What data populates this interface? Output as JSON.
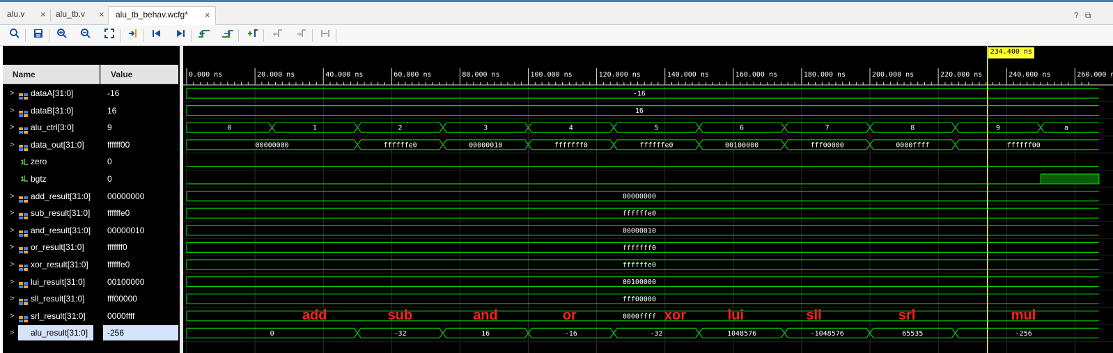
{
  "tabs": [
    {
      "label": "alu.v",
      "close": "×"
    },
    {
      "label": "alu_tb.v",
      "close": "×"
    },
    {
      "label": "alu_tb_behav.wcfg*",
      "close": "×"
    }
  ],
  "window_controls": {
    "help": "?",
    "restore": "⧉"
  },
  "toolbar": {
    "icons": [
      "search-icon",
      "save-icon",
      "zoom-in-icon",
      "zoom-out-icon",
      "zoom-fit-icon",
      "go-to-cursor-icon",
      "go-to-time-zero-icon",
      "go-to-last-time-icon",
      "previous-transition-icon",
      "next-transition-icon",
      "add-marker-icon",
      "previous-marker-icon",
      "next-marker-icon",
      "swap-cursors-icon"
    ]
  },
  "columns": {
    "name": "Name",
    "value": "Value"
  },
  "signals": [
    {
      "name": "dataA[31:0]",
      "value": "-16",
      "type": "bus"
    },
    {
      "name": "dataB[31:0]",
      "value": "16",
      "type": "bus"
    },
    {
      "name": "alu_ctrl[3:0]",
      "value": "9",
      "type": "bus"
    },
    {
      "name": "data_out[31:0]",
      "value": "ffffff00",
      "type": "bus"
    },
    {
      "name": "zero",
      "value": "0",
      "type": "bit"
    },
    {
      "name": "bgtz",
      "value": "0",
      "type": "bit"
    },
    {
      "name": "add_result[31:0]",
      "value": "00000000",
      "type": "bus"
    },
    {
      "name": "sub_result[31:0]",
      "value": "ffffffe0",
      "type": "bus"
    },
    {
      "name": "and_result[31:0]",
      "value": "00000010",
      "type": "bus"
    },
    {
      "name": "or_result[31:0]",
      "value": "fffffff0",
      "type": "bus"
    },
    {
      "name": "xor_result[31:0]",
      "value": "ffffffe0",
      "type": "bus"
    },
    {
      "name": "lui_result[31:0]",
      "value": "00100000",
      "type": "bus"
    },
    {
      "name": "sll_result[31:0]",
      "value": "fff00000",
      "type": "bus"
    },
    {
      "name": "srl_result[31:0]",
      "value": "0000ffff",
      "type": "bus"
    },
    {
      "name": "alu_result[31:0]",
      "value": "-256",
      "type": "bus",
      "selected": true
    }
  ],
  "timeline": {
    "ticks": [
      "0.000 ns",
      "20.000 ns",
      "40.000 ns",
      "60.000 ns",
      "80.000 ns",
      "100.000 ns",
      "120.000 ns",
      "140.000 ns",
      "160.000 ns",
      "180.000 ns",
      "200.000 ns",
      "220.000 ns",
      "240.000 ns",
      "260.000 ns"
    ],
    "cursor_label": "234.400 ns",
    "cursor_time_ns": 234.4,
    "visible_range_ns": [
      0,
      265
    ]
  },
  "waves": [
    {
      "segments": [
        {
          "t0": 0,
          "t1": 265,
          "label": "-16"
        }
      ]
    },
    {
      "segments": [
        {
          "t0": 0,
          "t1": 265,
          "label": "16"
        }
      ]
    },
    {
      "segments": [
        {
          "t0": 0,
          "t1": 25,
          "label": "0"
        },
        {
          "t0": 25,
          "t1": 50,
          "label": "1"
        },
        {
          "t0": 50,
          "t1": 75,
          "label": "2"
        },
        {
          "t0": 75,
          "t1": 100,
          "label": "3"
        },
        {
          "t0": 100,
          "t1": 125,
          "label": "4"
        },
        {
          "t0": 125,
          "t1": 150,
          "label": "5"
        },
        {
          "t0": 150,
          "t1": 175,
          "label": "6"
        },
        {
          "t0": 175,
          "t1": 200,
          "label": "7"
        },
        {
          "t0": 200,
          "t1": 225,
          "label": "8"
        },
        {
          "t0": 225,
          "t1": 250,
          "label": "9"
        },
        {
          "t0": 250,
          "t1": 265,
          "label": "a"
        }
      ]
    },
    {
      "segments": [
        {
          "t0": 0,
          "t1": 50,
          "label": "00000000"
        },
        {
          "t0": 50,
          "t1": 75,
          "label": "ffffffe0"
        },
        {
          "t0": 75,
          "t1": 100,
          "label": "00000010"
        },
        {
          "t0": 100,
          "t1": 125,
          "label": "fffffff0"
        },
        {
          "t0": 125,
          "t1": 150,
          "label": "ffffffe0"
        },
        {
          "t0": 150,
          "t1": 175,
          "label": "00100000"
        },
        {
          "t0": 175,
          "t1": 200,
          "label": "fff00000"
        },
        {
          "t0": 200,
          "t1": 225,
          "label": "0000ffff"
        },
        {
          "t0": 225,
          "t1": 265,
          "label": "ffffff00"
        }
      ]
    },
    {
      "bit": [
        {
          "t0": 0,
          "t1": 265,
          "v": 0
        }
      ]
    },
    {
      "bit": [
        {
          "t0": 0,
          "t1": 250,
          "v": 0
        },
        {
          "t0": 250,
          "t1": 265,
          "v": 1
        }
      ]
    },
    {
      "segments": [
        {
          "t0": 0,
          "t1": 265,
          "label": "00000000"
        }
      ]
    },
    {
      "segments": [
        {
          "t0": 0,
          "t1": 265,
          "label": "ffffffe0"
        }
      ]
    },
    {
      "segments": [
        {
          "t0": 0,
          "t1": 265,
          "label": "00000010"
        }
      ]
    },
    {
      "segments": [
        {
          "t0": 0,
          "t1": 265,
          "label": "fffffff0"
        }
      ]
    },
    {
      "segments": [
        {
          "t0": 0,
          "t1": 265,
          "label": "ffffffe0"
        }
      ]
    },
    {
      "segments": [
        {
          "t0": 0,
          "t1": 265,
          "label": "00100000"
        }
      ]
    },
    {
      "segments": [
        {
          "t0": 0,
          "t1": 265,
          "label": "fff00000"
        }
      ]
    },
    {
      "segments": [
        {
          "t0": 0,
          "t1": 265,
          "label": "0000ffff"
        }
      ]
    },
    {
      "segments": [
        {
          "t0": 0,
          "t1": 50,
          "label": "0"
        },
        {
          "t0": 50,
          "t1": 75,
          "label": "-32"
        },
        {
          "t0": 75,
          "t1": 100,
          "label": "16"
        },
        {
          "t0": 100,
          "t1": 125,
          "label": "-16"
        },
        {
          "t0": 125,
          "t1": 150,
          "label": "-32"
        },
        {
          "t0": 150,
          "t1": 175,
          "label": "1048576"
        },
        {
          "t0": 175,
          "t1": 200,
          "label": "-1048576"
        },
        {
          "t0": 200,
          "t1": 225,
          "label": "65535"
        },
        {
          "t0": 225,
          "t1": 265,
          "label": "-256"
        }
      ]
    }
  ],
  "annotations": [
    {
      "text": "add",
      "t": 37.5
    },
    {
      "text": "sub",
      "t": 62.5
    },
    {
      "text": "and",
      "t": 87.5
    },
    {
      "text": "or",
      "t": 112.5
    },
    {
      "text": "xor",
      "t": 143.5
    },
    {
      "text": "lui",
      "t": 162
    },
    {
      "text": "sll",
      "t": 185
    },
    {
      "text": "srl",
      "t": 212
    },
    {
      "text": "mul",
      "t": 245
    }
  ],
  "colors": {
    "wave": "#00d000",
    "cursor": "#ffff00",
    "annotation": "#ff2020",
    "bit_high_fill": "#0b5d0b"
  }
}
